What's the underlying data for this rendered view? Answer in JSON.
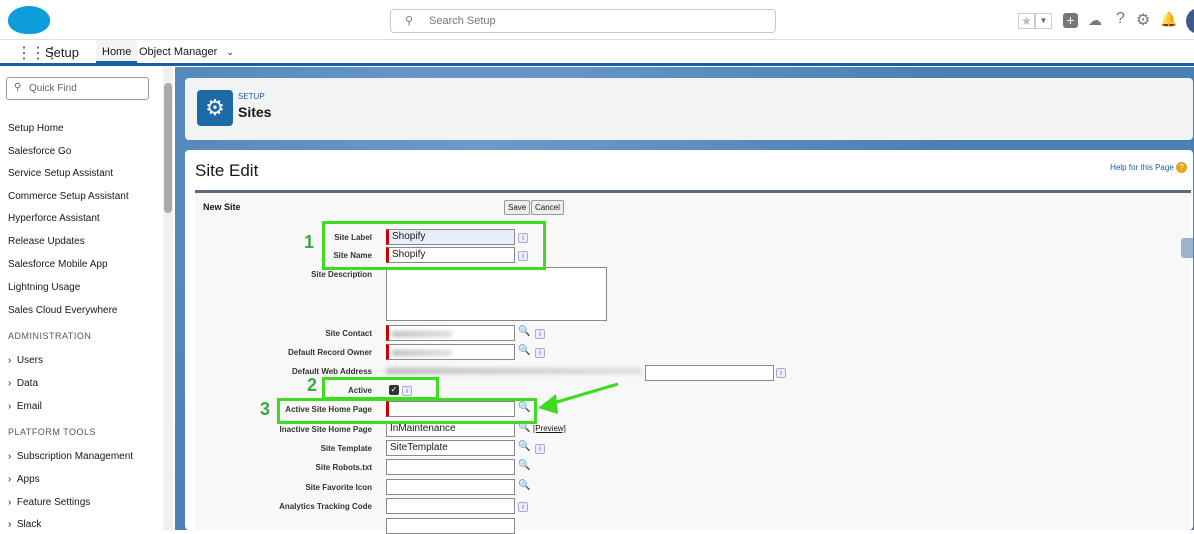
{
  "header": {
    "search_placeholder": "Search Setup",
    "icons": [
      "star-icon",
      "chevron-down-icon",
      "add-icon",
      "trailhead-icon",
      "help-icon",
      "gear-icon",
      "bell-icon",
      "avatar"
    ]
  },
  "nav": {
    "app_name": "Setup",
    "tabs": [
      "Home",
      "Object Manager"
    ]
  },
  "sidebar": {
    "quick_find_placeholder": "Quick Find",
    "items": [
      "Setup Home",
      "Salesforce Go",
      "Service Setup Assistant",
      "Commerce Setup Assistant",
      "Hyperforce Assistant",
      "Release Updates",
      "Salesforce Mobile App",
      "Lightning Usage",
      "Sales Cloud Everywhere"
    ],
    "section_admin": "ADMINISTRATION",
    "admin_items": [
      "Users",
      "Data",
      "Email"
    ],
    "section_platform": "PLATFORM TOOLS",
    "platform_items": [
      "Subscription Management",
      "Apps",
      "Feature Settings",
      "Slack"
    ]
  },
  "page_header": {
    "eyebrow": "SETUP",
    "title": "Sites"
  },
  "edit": {
    "title": "Site Edit",
    "help_link": "Help for this Page",
    "section_title": "New Site",
    "save": "Save",
    "cancel": "Cancel",
    "fields": {
      "site_label": {
        "label": "Site Label",
        "value": "Shopify"
      },
      "site_name": {
        "label": "Site Name",
        "value": "Shopify"
      },
      "site_description": {
        "label": "Site Description"
      },
      "site_contact": {
        "label": "Site Contact"
      },
      "default_record_owner": {
        "label": "Default Record Owner"
      },
      "default_web_address": {
        "label": "Default Web Address"
      },
      "active": {
        "label": "Active",
        "checked": true
      },
      "active_home": {
        "label": "Active Site Home Page",
        "value": ""
      },
      "inactive_home": {
        "label": "Inactive Site Home Page",
        "value": "InMaintenance",
        "preview": "[Preview]"
      },
      "site_template": {
        "label": "Site Template",
        "value": "SiteTemplate"
      },
      "robots": {
        "label": "Site Robots.txt",
        "value": ""
      },
      "favicon": {
        "label": "Site Favorite Icon",
        "value": ""
      },
      "analytics": {
        "label": "Analytics Tracking Code",
        "value": ""
      }
    }
  },
  "annotations": [
    "1",
    "2",
    "3"
  ]
}
